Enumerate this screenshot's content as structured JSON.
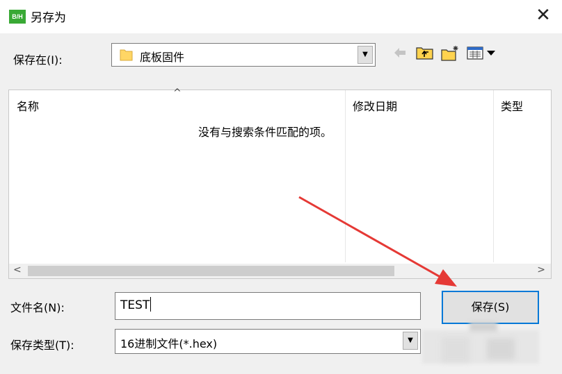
{
  "window": {
    "icon_text": "B/H",
    "title": "另存为",
    "close_glyph": "✕"
  },
  "save_in": {
    "label": "保存在(I):",
    "value": "底板固件"
  },
  "file_list": {
    "columns": [
      "名称",
      "修改日期",
      "类型"
    ],
    "empty_message": "没有与搜索条件匹配的项。"
  },
  "filename": {
    "label": "文件名(N):",
    "value": "TEST"
  },
  "file_type": {
    "label": "保存类型(T):",
    "value": "16进制文件(*.hex)"
  },
  "buttons": {
    "save": "保存(S)"
  },
  "icons": {
    "close": "close-icon",
    "folder": "folder-icon",
    "back": "back-arrow-icon",
    "up": "up-folder-icon",
    "new_folder": "new-folder-icon",
    "view": "view-menu-icon",
    "dropdown": "chevron-down-icon"
  },
  "colors": {
    "accent": "#0078d7",
    "annotation": "#e53935",
    "app_icon": "#39a935"
  }
}
